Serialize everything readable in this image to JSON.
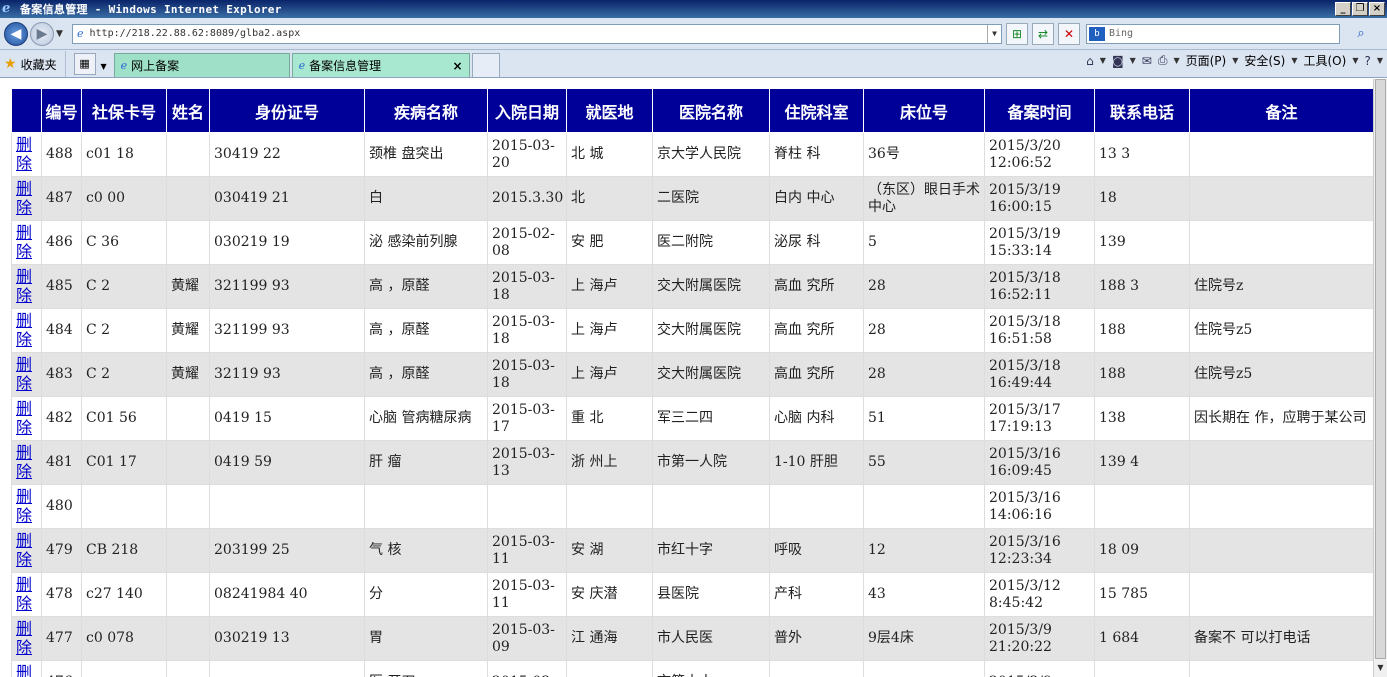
{
  "window": {
    "title": "备案信息管理 - Windows Internet Explorer"
  },
  "address": {
    "url": "http://218.22.88.62:8089/glba2.aspx",
    "search_placeholder": "Bing"
  },
  "tabs": {
    "favorites_label": "收藏夹",
    "items": [
      {
        "label": "网上备案"
      },
      {
        "label": "备案信息管理"
      }
    ],
    "close_glyph": "×"
  },
  "commandbar": {
    "page_label": "页面(P)",
    "safety_label": "安全(S)",
    "tools_label": "工具(O)"
  },
  "table": {
    "headers": [
      "",
      "编号",
      "社保卡号",
      "姓名",
      "身份证号",
      "疾病名称",
      "入院日期",
      "就医地",
      "医院名称",
      "住院科室",
      "床位号",
      "备案时间",
      "联系电话",
      "备注"
    ],
    "delete_label": "删除",
    "rows": [
      {
        "id": "488",
        "card": "c01    18",
        "name": "",
        "idno": "30419    22",
        "disease": "颈椎    盘突出",
        "admit": "2015-03-20",
        "place": "北    城",
        "hospital": "京大学人民院",
        "dept": "脊柱    科",
        "bed": "36号",
        "time": "2015/3/20 12:06:52",
        "phone": "13    3",
        "note": ""
      },
      {
        "id": "487",
        "card": "c0    00",
        "name": "",
        "idno": "030419    21",
        "disease": "白",
        "admit": "2015.3.30",
        "place": "北",
        "hospital": "二医院",
        "dept": "白内    中心",
        "bed": "（东区）眼日手术中心",
        "time": "2015/3/19 16:00:15",
        "phone": "18",
        "note": ""
      },
      {
        "id": "486",
        "card": "C    36",
        "name": "",
        "idno": "030219    19",
        "disease": "泌    感染前列腺",
        "admit": "2015-02-08",
        "place": "安    肥",
        "hospital": "医二附院",
        "dept": "泌尿    科",
        "bed": "5",
        "time": "2015/3/19 15:33:14",
        "phone": "139",
        "note": ""
      },
      {
        "id": "485",
        "card": "C    2",
        "name": "黄耀",
        "idno": "321199    93",
        "disease": "高    ，原醛",
        "admit": "2015-03-18",
        "place": "上    海卢",
        "hospital": "交大附属医院",
        "dept": "高血    究所",
        "bed": "28",
        "time": "2015/3/18 16:52:11",
        "phone": "188    3",
        "note": "住院号z"
      },
      {
        "id": "484",
        "card": "C    2",
        "name": "黄耀",
        "idno": "321199    93",
        "disease": "高    ，原醛",
        "admit": "2015-03-18",
        "place": "上    海卢",
        "hospital": "交大附属医院",
        "dept": "高血    究所",
        "bed": "28",
        "time": "2015/3/18 16:51:58",
        "phone": "188",
        "note": "住院号z5"
      },
      {
        "id": "483",
        "card": "C    2",
        "name": "黄耀",
        "idno": "32119    93",
        "disease": "高    ，原醛",
        "admit": "2015-03-18",
        "place": "上    海卢",
        "hospital": "交大附属医院",
        "dept": "高血    究所",
        "bed": "28",
        "time": "2015/3/18 16:49:44",
        "phone": "188",
        "note": "住院号z5"
      },
      {
        "id": "482",
        "card": "C01    56",
        "name": "",
        "idno": "0419    15",
        "disease": "心脑    管病糖尿病",
        "admit": "2015-03-17",
        "place": "重    北",
        "hospital": "军三二四",
        "dept": "心脑    内科",
        "bed": "51",
        "time": "2015/3/17 17:19:13",
        "phone": "138",
        "note": "因长期在    作，应聘于某公司"
      },
      {
        "id": "481",
        "card": "C01    17",
        "name": "",
        "idno": "0419    59",
        "disease": "肝    瘤",
        "admit": "2015-03-13",
        "place": "浙    州上",
        "hospital": "市第一人院",
        "dept": "1-10    肝胆",
        "bed": "55",
        "time": "2015/3/16 16:09:45",
        "phone": "139    4",
        "note": ""
      },
      {
        "id": "480",
        "card": "",
        "name": "",
        "idno": "",
        "disease": "",
        "admit": "",
        "place": "",
        "hospital": "",
        "dept": "",
        "bed": "",
        "time": "2015/3/16 14:06:16",
        "phone": "",
        "note": ""
      },
      {
        "id": "479",
        "card": "CB    218",
        "name": "",
        "idno": "203199    25",
        "disease": "气    核",
        "admit": "2015-03-11",
        "place": "安    湖",
        "hospital": "市红十字",
        "dept": "呼吸",
        "bed": "12",
        "time": "2015/3/16 12:23:34",
        "phone": "18    09",
        "note": ""
      },
      {
        "id": "478",
        "card": "c27    140",
        "name": "",
        "idno": "08241984    40",
        "disease": "分",
        "admit": "2015-03-11",
        "place": "安    庆潜",
        "hospital": "县医院",
        "dept": "产科",
        "bed": "43",
        "time": "2015/3/12 8:45:42",
        "phone": "15    785",
        "note": ""
      },
      {
        "id": "477",
        "card": "c0    078",
        "name": "",
        "idno": "030219    13",
        "disease": "胃",
        "admit": "2015-03-09",
        "place": "江    通海",
        "hospital": "市人民医",
        "dept": "普外",
        "bed": "9层4床",
        "time": "2015/3/9 21:20:22",
        "phone": "1    684",
        "note": "备案不    可以打电话"
      },
      {
        "id": "476",
        "card": "",
        "name": "",
        "idno": "",
        "disease": "医    开刀,",
        "admit": "2015-03-",
        "place": "",
        "hospital": "市第十人",
        "dept": "",
        "bed": "",
        "time": "2015/3/9",
        "phone": "",
        "note": ""
      }
    ]
  }
}
